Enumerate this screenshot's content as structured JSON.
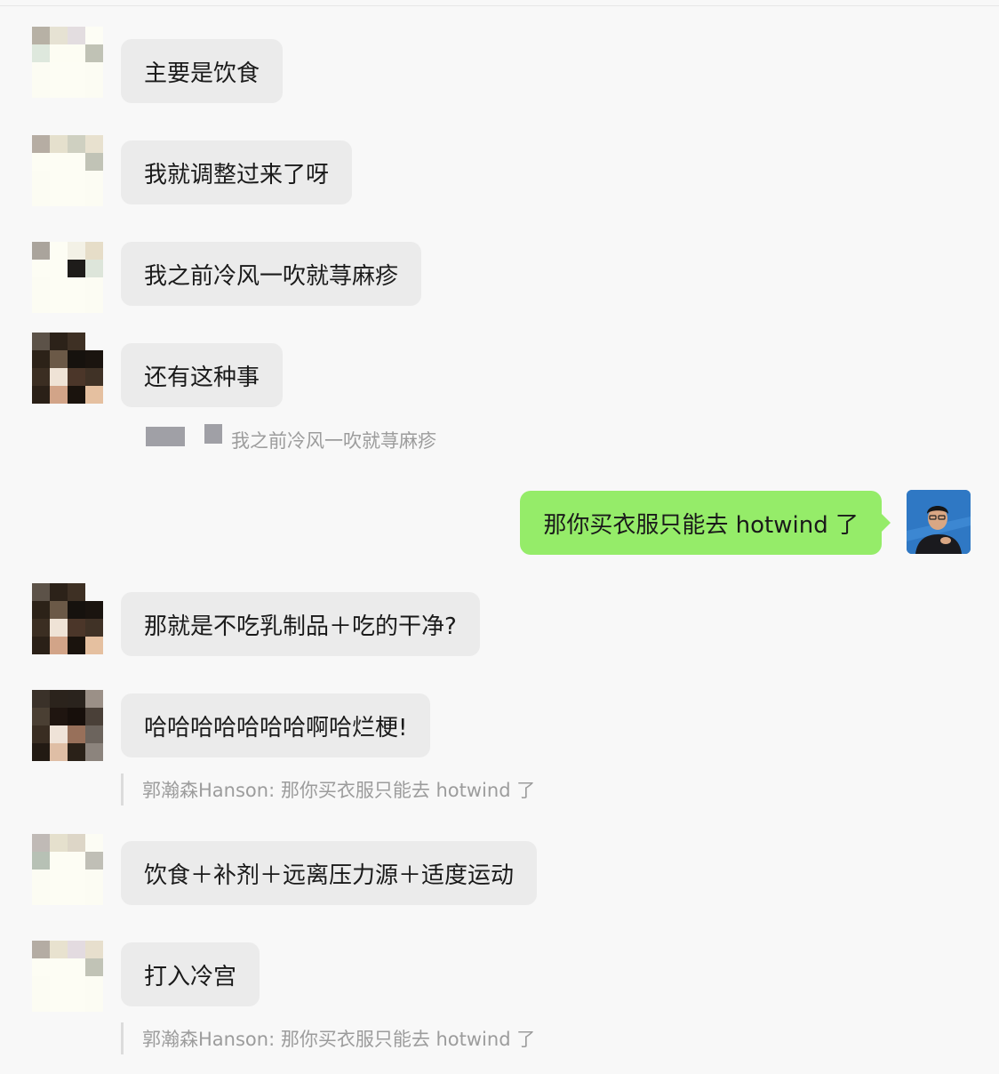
{
  "messages": [
    {
      "text": "主要是饮食"
    },
    {
      "text": "我就调整过来了呀"
    },
    {
      "text": "我之前冷风一吹就荨麻疹"
    },
    {
      "text": "还有这种事",
      "quote": "我之前冷风一吹就荨麻疹"
    },
    {
      "text": "那你买衣服只能去 hotwind 了"
    },
    {
      "text": "那就是不吃乳制品＋吃的干净?"
    },
    {
      "text": "哈哈哈哈哈哈哈啊哈烂梗!",
      "quote": "郭瀚森Hanson: 那你买衣服只能去 hotwind 了"
    },
    {
      "text": "饮食＋补剂＋远离压力源＋适度运动"
    },
    {
      "text": "打入冷宫",
      "quote": "郭瀚森Hanson: 那你买衣服只能去 hotwind 了"
    }
  ],
  "colors": {
    "background": "#f8f8f8",
    "incoming_bubble": "#ebebeb",
    "outgoing_bubble": "#95ec69",
    "quote_text": "#9c9c9c"
  },
  "icons": {
    "avatar_pixelated": "pixelated-avatar-icon",
    "avatar_me": "user-photo-icon"
  }
}
